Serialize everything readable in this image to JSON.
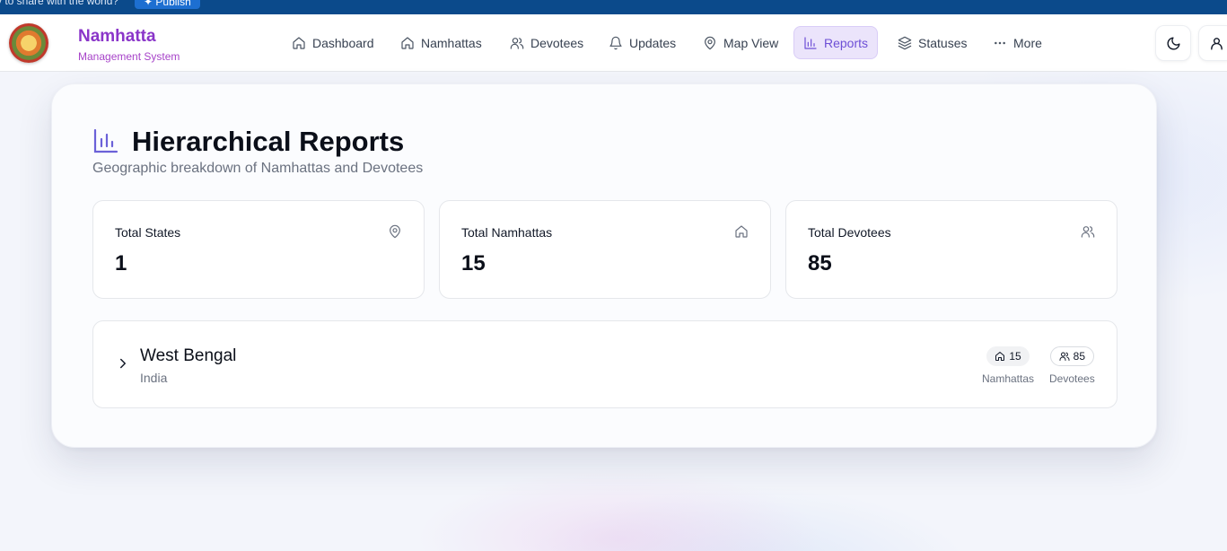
{
  "publish_bar": {
    "message": "y to share with the world?",
    "button_label": "Publish"
  },
  "brand": {
    "title": "Namhatta",
    "subtitle": "Management System"
  },
  "nav": {
    "items": [
      {
        "label": "Dashboard",
        "icon": "home-icon"
      },
      {
        "label": "Namhattas",
        "icon": "home-icon"
      },
      {
        "label": "Devotees",
        "icon": "users-icon"
      },
      {
        "label": "Updates",
        "icon": "bell-icon"
      },
      {
        "label": "Map View",
        "icon": "map-pin-icon"
      },
      {
        "label": "Reports",
        "icon": "bar-chart-icon",
        "active": true
      },
      {
        "label": "Statuses",
        "icon": "layers-icon"
      },
      {
        "label": "More",
        "icon": "more-horizontal-icon"
      }
    ]
  },
  "page": {
    "title": "Hierarchical Reports",
    "subtitle": "Geographic breakdown of Namhattas and Devotees"
  },
  "stats": [
    {
      "label": "Total States",
      "value": "1",
      "icon": "map-pin-icon"
    },
    {
      "label": "Total Namhattas",
      "value": "15",
      "icon": "home-icon"
    },
    {
      "label": "Total Devotees",
      "value": "85",
      "icon": "users-icon"
    }
  ],
  "states": [
    {
      "name": "West Bengal",
      "country": "India",
      "namhattas_count": "15",
      "namhattas_label": "Namhattas",
      "devotees_count": "85",
      "devotees_label": "Devotees"
    }
  ],
  "colors": {
    "brand_purple": "#8a35c9",
    "active_nav_bg": "#ebe4fb",
    "active_nav_text": "#6d4fd6",
    "publish_bar": "#0b4a8b"
  }
}
